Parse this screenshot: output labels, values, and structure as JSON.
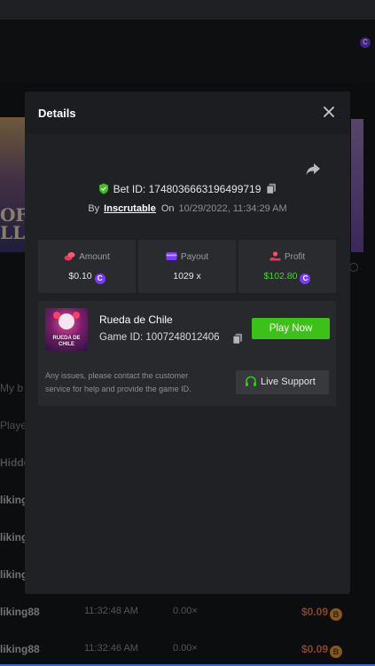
{
  "background": {
    "banner_text": "OF\nLLC",
    "filter_label": "My b",
    "col_player": "Player",
    "hidden_label": "Hidde",
    "rows": [
      {
        "player": "liking",
        "time": "",
        "mult": "",
        "payout": ""
      },
      {
        "player": "liking",
        "time": "",
        "mult": "",
        "payout": ""
      },
      {
        "player": "liking",
        "time": "",
        "mult": "",
        "payout": ""
      },
      {
        "player": "liking88",
        "time": "11:32:48 AM",
        "mult": "0.00×",
        "payout": "$0.09"
      },
      {
        "player": "liking88",
        "time": "11:32:46 AM",
        "mult": "0.00×",
        "payout": "$0.09"
      }
    ]
  },
  "modal": {
    "title": "Details",
    "bet_id_label": "Bet ID: 1748036663196499719",
    "by_label": "By",
    "username": "Inscrutable",
    "on_label": "On",
    "datetime": "10/29/2022, 11:34:29 AM",
    "stats": {
      "amount_label": "Amount",
      "amount_value": "$0.10",
      "payout_label": "Payout",
      "payout_value": "1029 x",
      "profit_label": "Profit",
      "profit_value": "$102.80"
    },
    "game": {
      "thumb_text": "RUEDA DE CHILE",
      "name": "Rueda de Chile",
      "game_id_label": "Game ID: 1007248012406",
      "play_label": "Play Now",
      "issues_text": "Any issues, please contact the customer service for help and provide the game ID.",
      "support_label": "Live Support"
    },
    "coin_symbol": "C"
  },
  "colors": {
    "accent_green": "#3bc117",
    "profit_green": "#44d62c",
    "coin_purple": "#7b39ff",
    "modal_bg": "#202124"
  }
}
